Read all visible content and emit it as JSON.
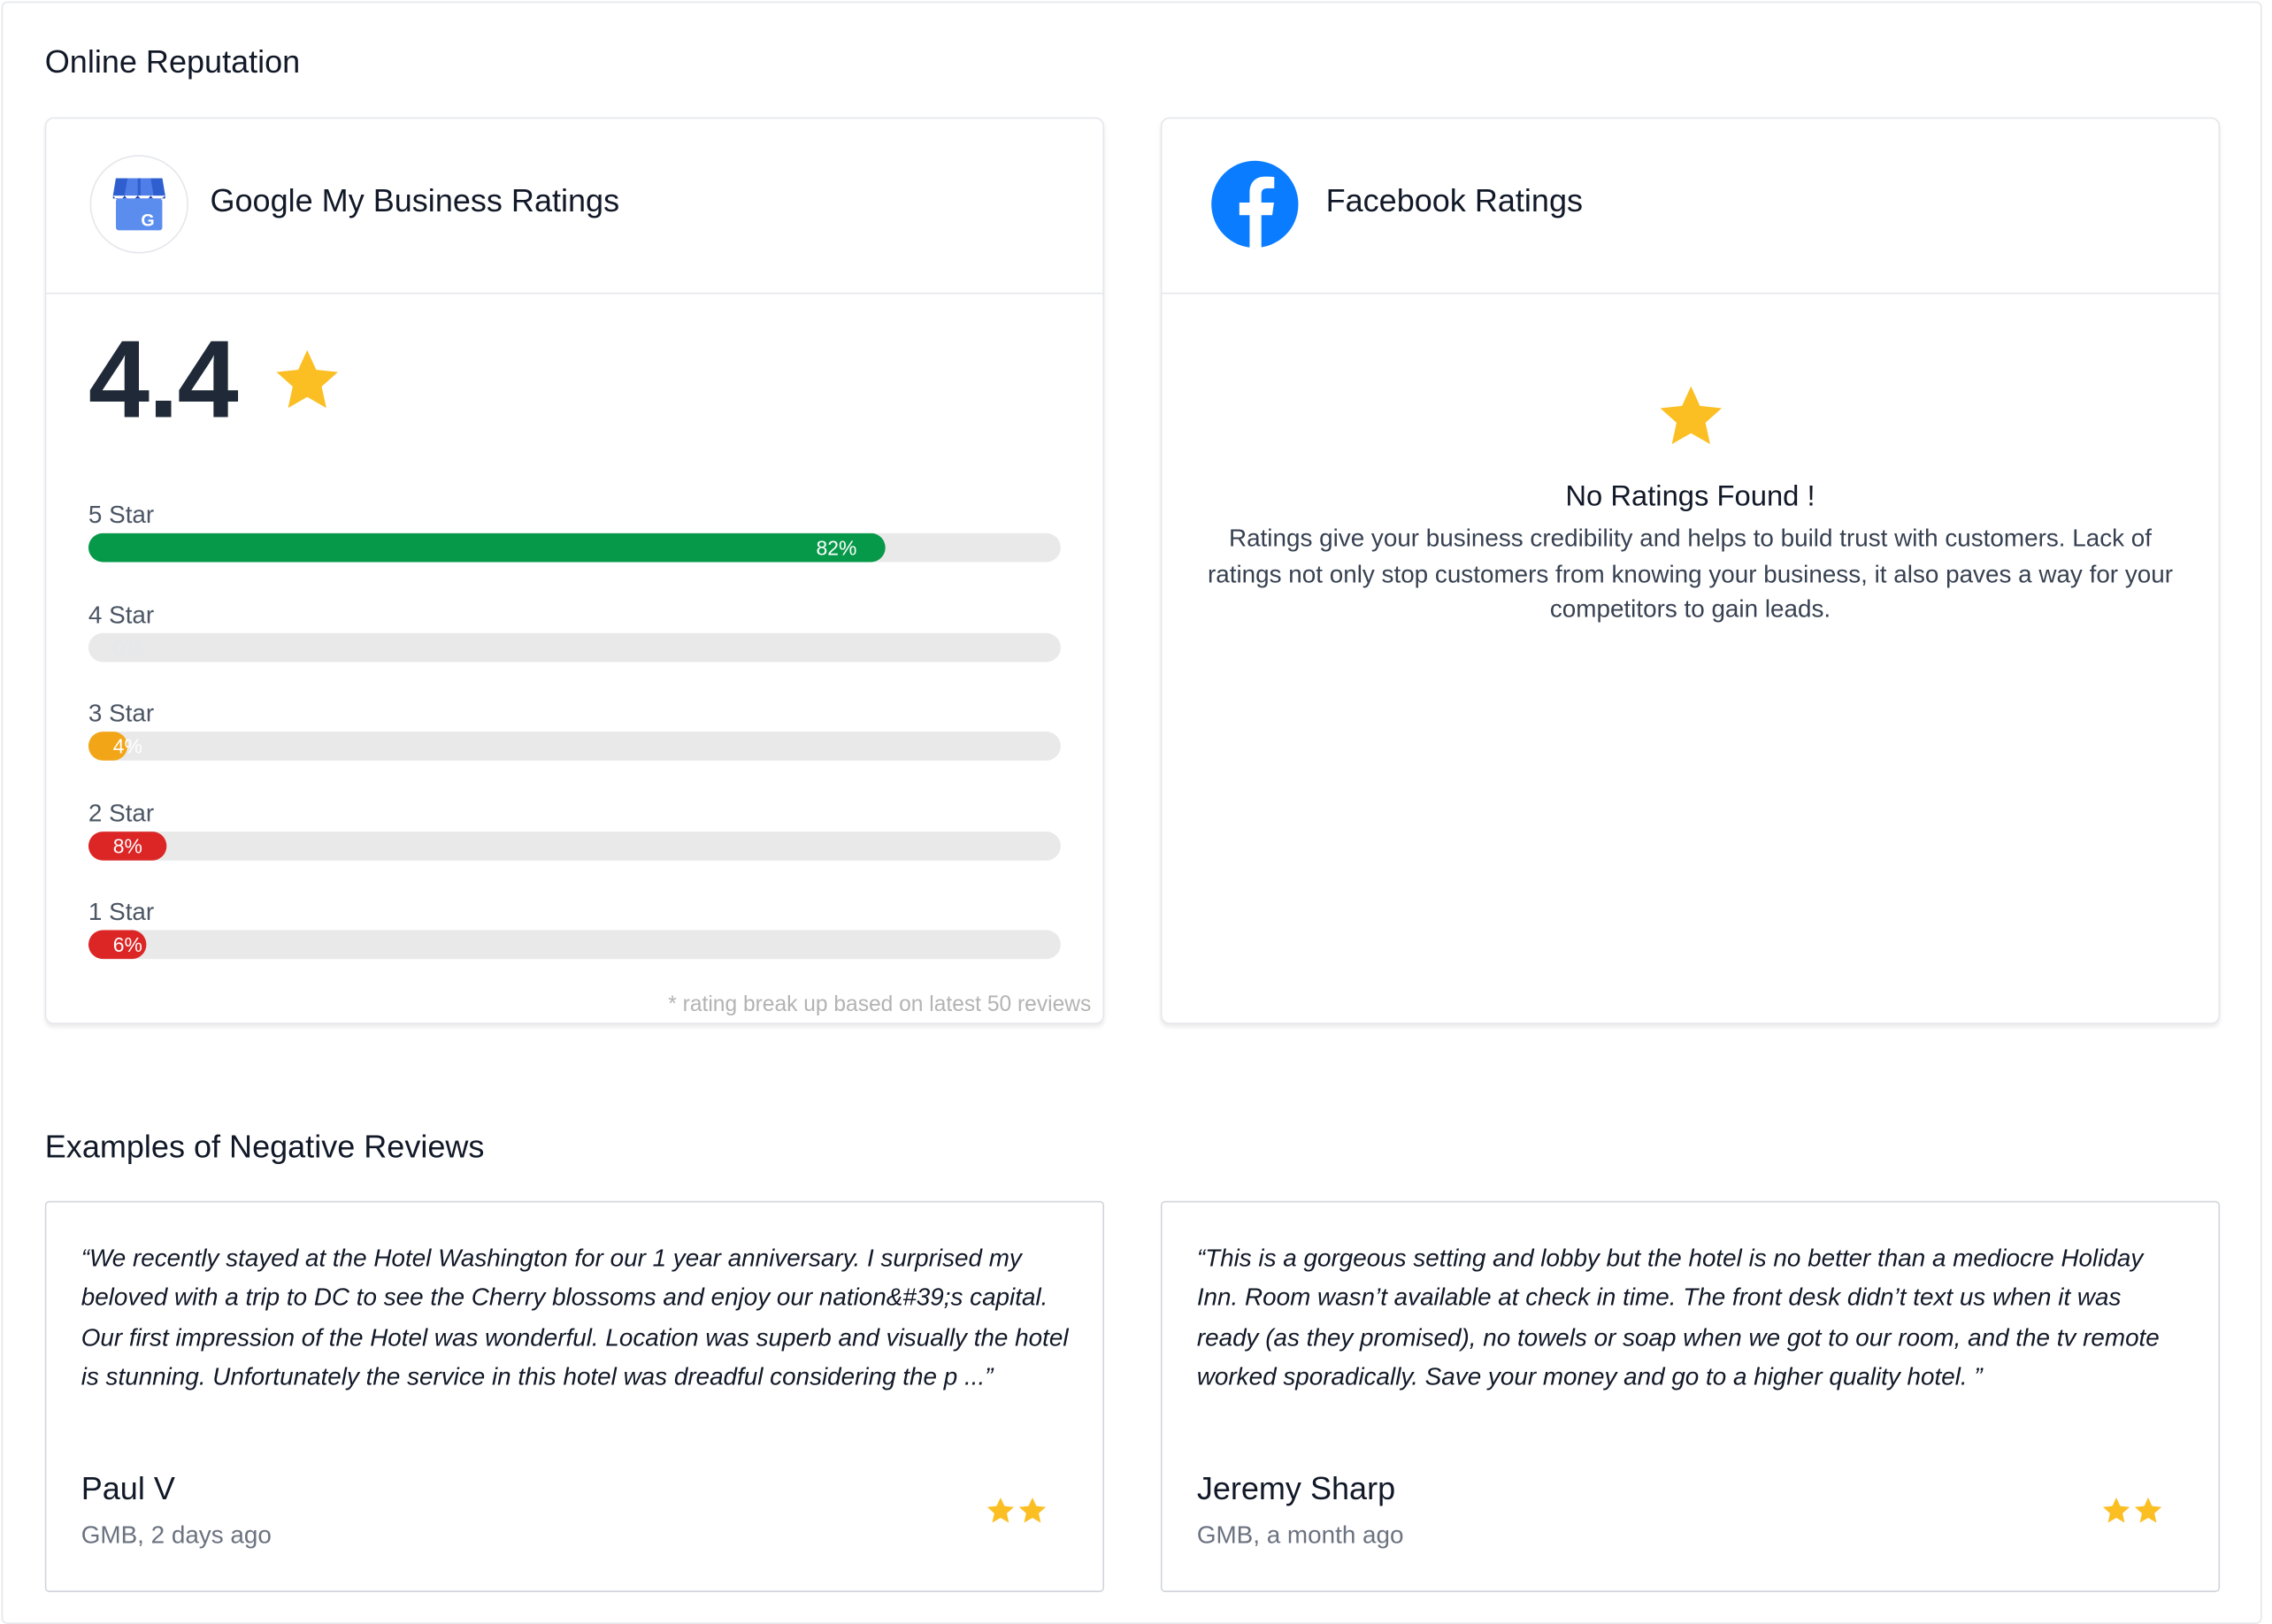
{
  "page": {
    "section_reputation_title": "Online Reputation",
    "section_reviews_title": "Examples of Negative Reviews"
  },
  "colors": {
    "star": "#fbbf24",
    "green": "#07994a",
    "amber": "#f2a516",
    "red": "#dc2626",
    "track": "#e9e9e9"
  },
  "google": {
    "title": "Google My Business Ratings",
    "logo_icon": "google-my-business-icon",
    "rating": "4.4",
    "rows": [
      {
        "label": "5 Star",
        "percent": 82,
        "percent_text": "82%",
        "color": "green"
      },
      {
        "label": "4 Star",
        "percent": 0,
        "percent_text": "0%",
        "color": "none"
      },
      {
        "label": "3 Star",
        "percent": 4,
        "percent_text": "4%",
        "color": "amber"
      },
      {
        "label": "2 Star",
        "percent": 8,
        "percent_text": "8%",
        "color": "red"
      },
      {
        "label": "1 Star",
        "percent": 6,
        "percent_text": "6%",
        "color": "red"
      }
    ],
    "footnote": "* rating break up based on latest 50 reviews"
  },
  "facebook": {
    "title": "Facebook Ratings",
    "logo_icon": "facebook-icon",
    "empty_title": "No Ratings Found !",
    "empty_body": "Ratings give your business credibility and helps to build trust with customers. Lack of ratings not only stop customers from knowing your business, it also paves a way for your competitors to gain leads."
  },
  "reviews": [
    {
      "text": "“We recently stayed at the Hotel Washington for our 1 year anniversary. I surprised my beloved with a trip to DC to see the Cherry blossoms and enjoy our nation&#39;s capital. Our first impression of the Hotel was wonderful. Location was superb and visually the hotel is stunning. Unfortunately the service in this hotel was dreadful considering the p ...”",
      "author": "Paul V",
      "meta": "GMB, 2 days ago",
      "stars": 2
    },
    {
      "text": "“This is a gorgeous setting and lobby but the hotel is no better than a mediocre Holiday Inn. Room wasn’t available at check in time. The front desk didn’t text us when it was ready (as they promised), no towels or soap when we got to our room, and the tv remote worked sporadically. Save your money and go to a higher quality hotel. ”",
      "author": "Jeremy Sharp",
      "meta": "GMB, a month ago",
      "stars": 2
    }
  ]
}
